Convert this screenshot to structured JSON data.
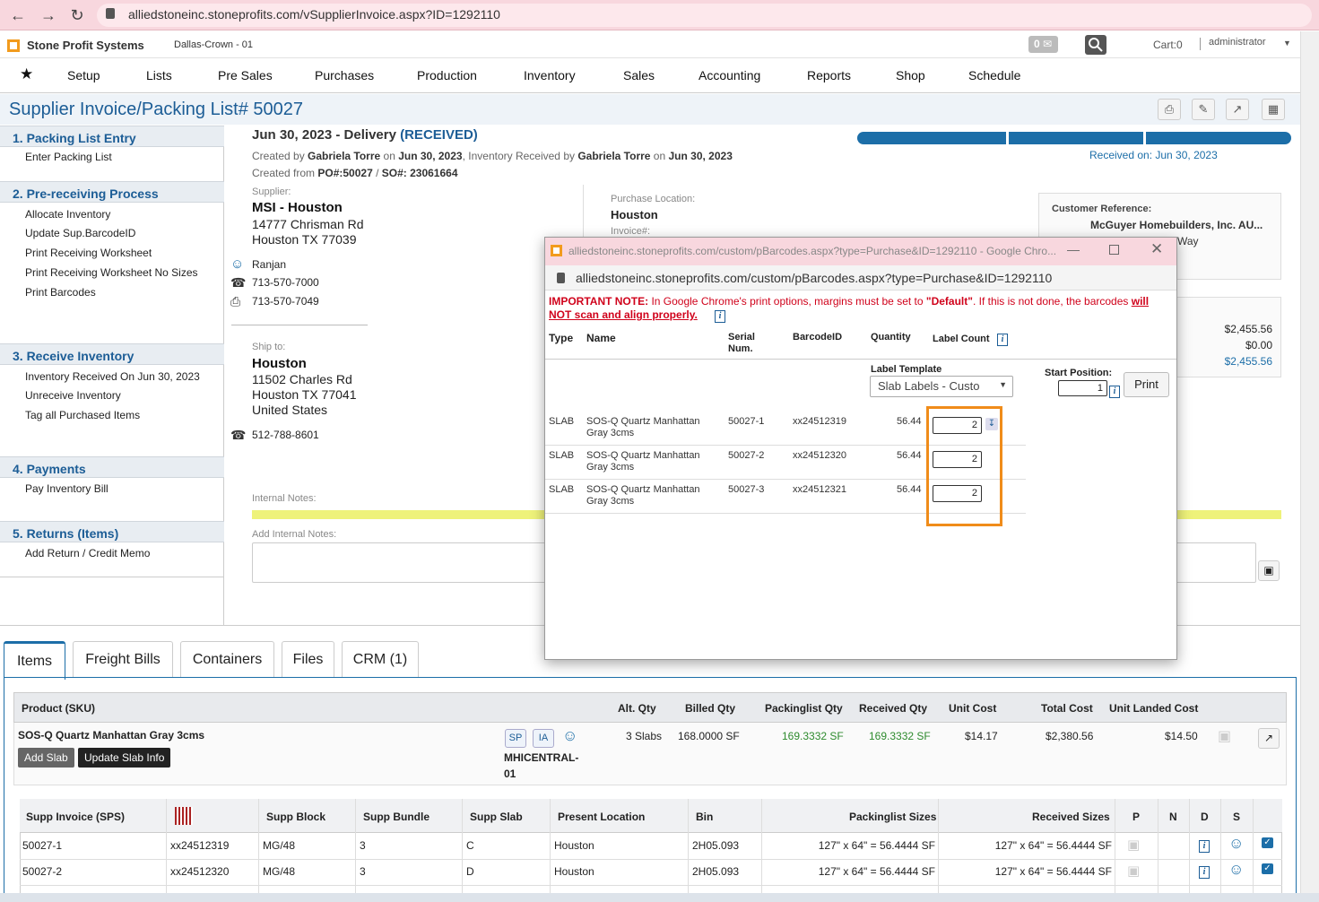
{
  "browser": {
    "url": "alliedstoneinc.stoneprofits.com/vSupplierInvoice.aspx?ID=1292110"
  },
  "header": {
    "brand": "Stone Profit Systems",
    "location": "Dallas-Crown - 01",
    "mail_count": "0",
    "cart": "Cart:0",
    "user": "administrator"
  },
  "nav": {
    "items": [
      "Setup",
      "Lists",
      "Pre Sales",
      "Purchases",
      "Production",
      "Inventory",
      "Sales",
      "Accounting",
      "Reports",
      "Shop",
      "Schedule"
    ]
  },
  "page": {
    "title": "Supplier Invoice/Packing List# 50027"
  },
  "sidebar": {
    "s1": {
      "title": "1. Packing List Entry",
      "links": [
        "Enter Packing List"
      ]
    },
    "s2": {
      "title": "2. Pre-receiving Process",
      "links": [
        "Allocate Inventory",
        "Update Sup.BarcodeID",
        "Print Receiving Worksheet",
        "Print Receiving Worksheet No Sizes",
        "Print Barcodes"
      ]
    },
    "s3": {
      "title": "3. Receive Inventory",
      "links": [
        "Inventory Received On Jun 30, 2023",
        "Unreceive Inventory",
        "Tag all Purchased Items"
      ]
    },
    "s4": {
      "title": "4. Payments",
      "links": [
        "Pay Inventory Bill"
      ]
    },
    "s5": {
      "title": "5. Returns (Items)",
      "links": [
        "Add Return / Credit Memo"
      ]
    }
  },
  "main": {
    "date_line": "Jun 30, 2023 - Delivery",
    "status": "(RECEIVED)",
    "created_line": {
      "p1": "Created by ",
      "by": "Gabriela Torre",
      "p2": " on ",
      "on": "Jun 30, 2023",
      "p3": ", Inventory Received by ",
      "rby": "Gabriela Torre",
      "p4": " on ",
      "ron": "Jun 30, 2023"
    },
    "created_from": {
      "p1": "Created from ",
      "po": "PO#:50027",
      "p2": " / ",
      "so": "SO#: 23061664"
    },
    "received_on": "Received on: Jun 30, 2023",
    "supplier": {
      "label": "Supplier:",
      "name": "MSI - Houston",
      "addr1": "14777 Chrisman Rd",
      "addr2": "Houston TX 77039",
      "contact": "Ranjan",
      "phone": "713-570-7000",
      "fax": "713-570-7049"
    },
    "purchase_location": {
      "label": "Purchase Location:",
      "value": "Houston",
      "invoice_label": "Invoice#:"
    },
    "customer_ref": {
      "label": "Customer Reference:",
      "name": "McGuyer Homebuilders, Inc. AU...",
      "partial": "Way"
    },
    "totals": [
      "$2,455.56",
      "$0.00",
      "$2,455.56"
    ],
    "ship_to": {
      "label": "Ship to:",
      "name": "Houston",
      "addr1": "11502 Charles Rd",
      "addr2": "Houston TX 77041",
      "country": "United States",
      "phone": "512-788-8601"
    },
    "internal_notes_label": "Internal Notes:",
    "add_notes_label": "Add Internal Notes:"
  },
  "tabs": [
    "Items",
    "Freight Bills",
    "Containers",
    "Files",
    "CRM (1)"
  ],
  "items_table": {
    "headers": [
      "Product (SKU)",
      "Alt. Qty",
      "Billed Qty",
      "Packinglist Qty",
      "Received Qty",
      "Unit Cost",
      "Total Cost",
      "Unit Landed Cost"
    ],
    "row": {
      "product": "SOS-Q Quartz Manhattan Gray 3cms",
      "add_slab": "Add Slab",
      "update_slab": "Update Slab Info",
      "sp": "SP",
      "ia": "IA",
      "sku1": "MHICENTRAL-",
      "sku2": "01",
      "alt_qty": "3 Slabs",
      "billed_qty": "168.0000 SF",
      "packing_qty": "169.3332 SF",
      "received_qty": "169.3332 SF",
      "unit_cost": "$14.17",
      "total_cost": "$2,380.56",
      "unit_landed": "$14.50"
    }
  },
  "slabs_table": {
    "headers": [
      "Supp Invoice (SPS)",
      "Supp Block",
      "Supp Bundle",
      "Supp Slab",
      "Present Location",
      "Bin",
      "Packinglist Sizes",
      "Received Sizes",
      "P",
      "N",
      "D",
      "S"
    ],
    "rows": [
      {
        "invoice": "50027-1",
        "barcode": "xx24512319",
        "block": "MG/48",
        "bundle": "3",
        "slab": "C",
        "location": "Houston",
        "bin": "2H05.093",
        "pl_size": "127\" x 64\" = 56.4444 SF",
        "rec_size": "127\" x 64\" = 56.4444 SF"
      },
      {
        "invoice": "50027-2",
        "barcode": "xx24512320",
        "block": "MG/48",
        "bundle": "3",
        "slab": "D",
        "location": "Houston",
        "bin": "2H05.093",
        "pl_size": "127\" x 64\" = 56.4444 SF",
        "rec_size": "127\" x 64\" = 56.4444 SF"
      }
    ]
  },
  "popup": {
    "title": "alliedstoneinc.stoneprofits.com/custom/pBarcodes.aspx?type=Purchase&ID=1292110 - Google Chro...",
    "url": "alliedstoneinc.stoneprofits.com/custom/pBarcodes.aspx?type=Purchase&ID=1292110",
    "note": {
      "label": "IMPORTANT NOTE:",
      "text1": " In Google Chrome's print options, margins must be set to ",
      "default": "\"Default\"",
      "text2": ". If this is not done, the barcodes ",
      "warn": "will NOT scan and align properly."
    },
    "headers": {
      "type": "Type",
      "name": "Name",
      "serial1": "Serial",
      "serial2": "Num.",
      "barcode": "BarcodeID",
      "quantity": "Quantity",
      "label_count": "Label Count"
    },
    "label_template_label": "Label Template",
    "label_template_value": "Slab Labels - Custo",
    "start_position_label": "Start Position:",
    "start_position_value": "1",
    "print_label": "Print",
    "rows": [
      {
        "type": "SLAB",
        "name1": "SOS-Q Quartz Manhattan",
        "name2": "Gray 3cms",
        "serial": "50027-1",
        "barcode": "xx24512319",
        "qty": "56.44",
        "count": "2"
      },
      {
        "type": "SLAB",
        "name1": "SOS-Q Quartz Manhattan",
        "name2": "Gray 3cms",
        "serial": "50027-2",
        "barcode": "xx24512320",
        "qty": "56.44",
        "count": "2"
      },
      {
        "type": "SLAB",
        "name1": "SOS-Q Quartz Manhattan",
        "name2": "Gray 3cms",
        "serial": "50027-3",
        "barcode": "xx24512321",
        "qty": "56.44",
        "count": "2"
      }
    ]
  },
  "colors": {
    "brand_blue": "#1c5d96",
    "highlight_orange": "#f08c1a",
    "received_green": "#2e8b2e",
    "note_red": "#d0021b"
  }
}
